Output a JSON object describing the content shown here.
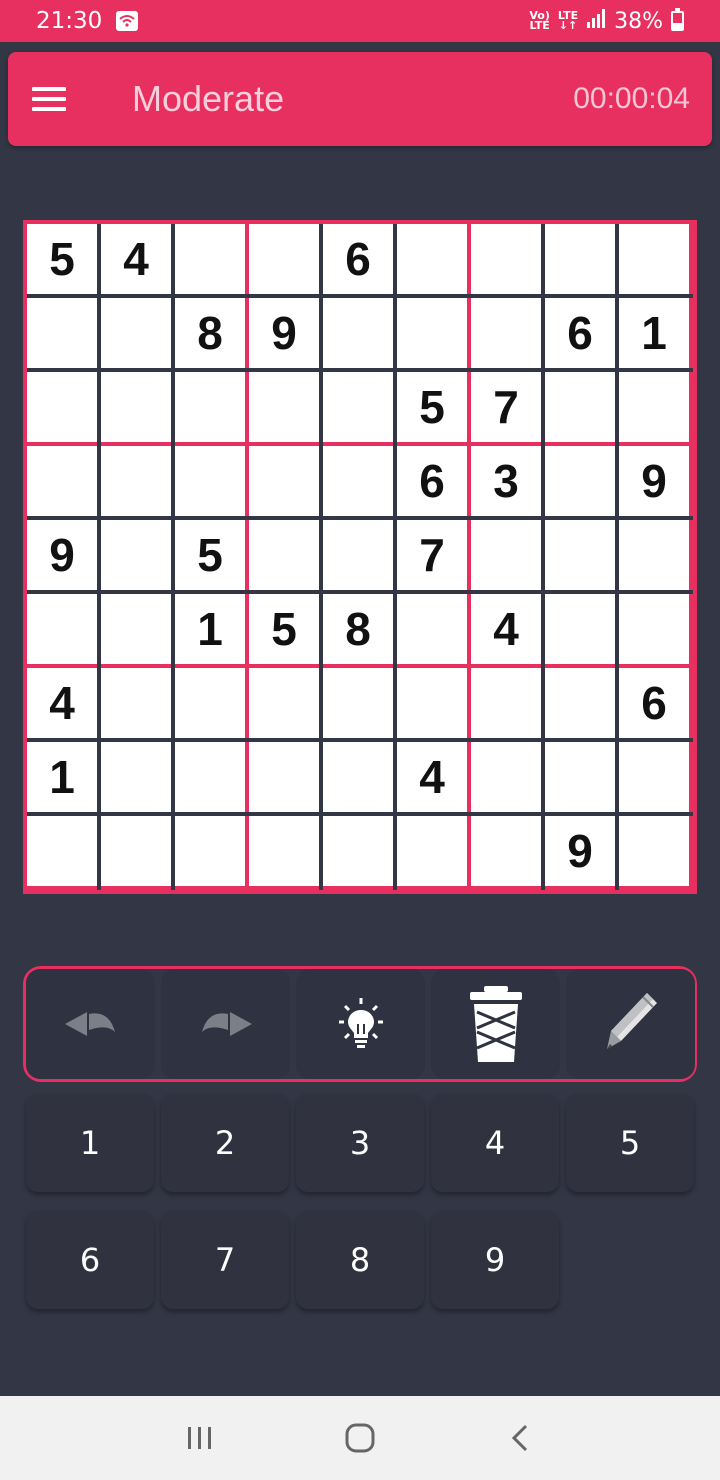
{
  "status_bar": {
    "time": "21:30",
    "network_top": "Vo)",
    "network_bottom": "LTE",
    "lte_label": "LTE",
    "battery": "38%",
    "icons": [
      "wifi-icon",
      "signal-icon",
      "battery-icon"
    ]
  },
  "app_bar": {
    "title": "Moderate",
    "timer": "00:00:04"
  },
  "board": {
    "grid": [
      [
        "5",
        "4",
        "",
        "",
        "6",
        "",
        "",
        "",
        ""
      ],
      [
        "",
        "",
        "8",
        "9",
        "",
        "",
        "",
        "6",
        "1"
      ],
      [
        "",
        "",
        "",
        "",
        "",
        "5",
        "7",
        "",
        ""
      ],
      [
        "",
        "",
        "",
        "",
        "",
        "6",
        "3",
        "",
        "9"
      ],
      [
        "9",
        "",
        "5",
        "",
        "",
        "7",
        "",
        "",
        ""
      ],
      [
        "",
        "",
        "1",
        "5",
        "8",
        "",
        "4",
        "",
        ""
      ],
      [
        "4",
        "",
        "",
        "",
        "",
        "",
        "",
        "",
        "6"
      ],
      [
        "1",
        "",
        "",
        "",
        "",
        "4",
        "",
        "",
        ""
      ],
      [
        "",
        "",
        "",
        "",
        "",
        "",
        "",
        "9",
        ""
      ]
    ]
  },
  "toolbar": {
    "buttons": [
      {
        "name": "undo-button",
        "icon": "undo-icon"
      },
      {
        "name": "redo-button",
        "icon": "redo-icon"
      },
      {
        "name": "hint-button",
        "icon": "lightbulb-icon"
      },
      {
        "name": "erase-button",
        "icon": "trash-icon"
      },
      {
        "name": "notes-button",
        "icon": "pencil-icon"
      }
    ]
  },
  "numpad": [
    "1",
    "2",
    "3",
    "4",
    "5",
    "6",
    "7",
    "8",
    "9"
  ],
  "nav_bar": {
    "buttons": [
      "recent-apps-icon",
      "home-icon",
      "back-icon"
    ]
  },
  "colors": {
    "accent": "#e83060",
    "background": "#333645",
    "cell": "#ffffff",
    "button": "#2f3241"
  }
}
